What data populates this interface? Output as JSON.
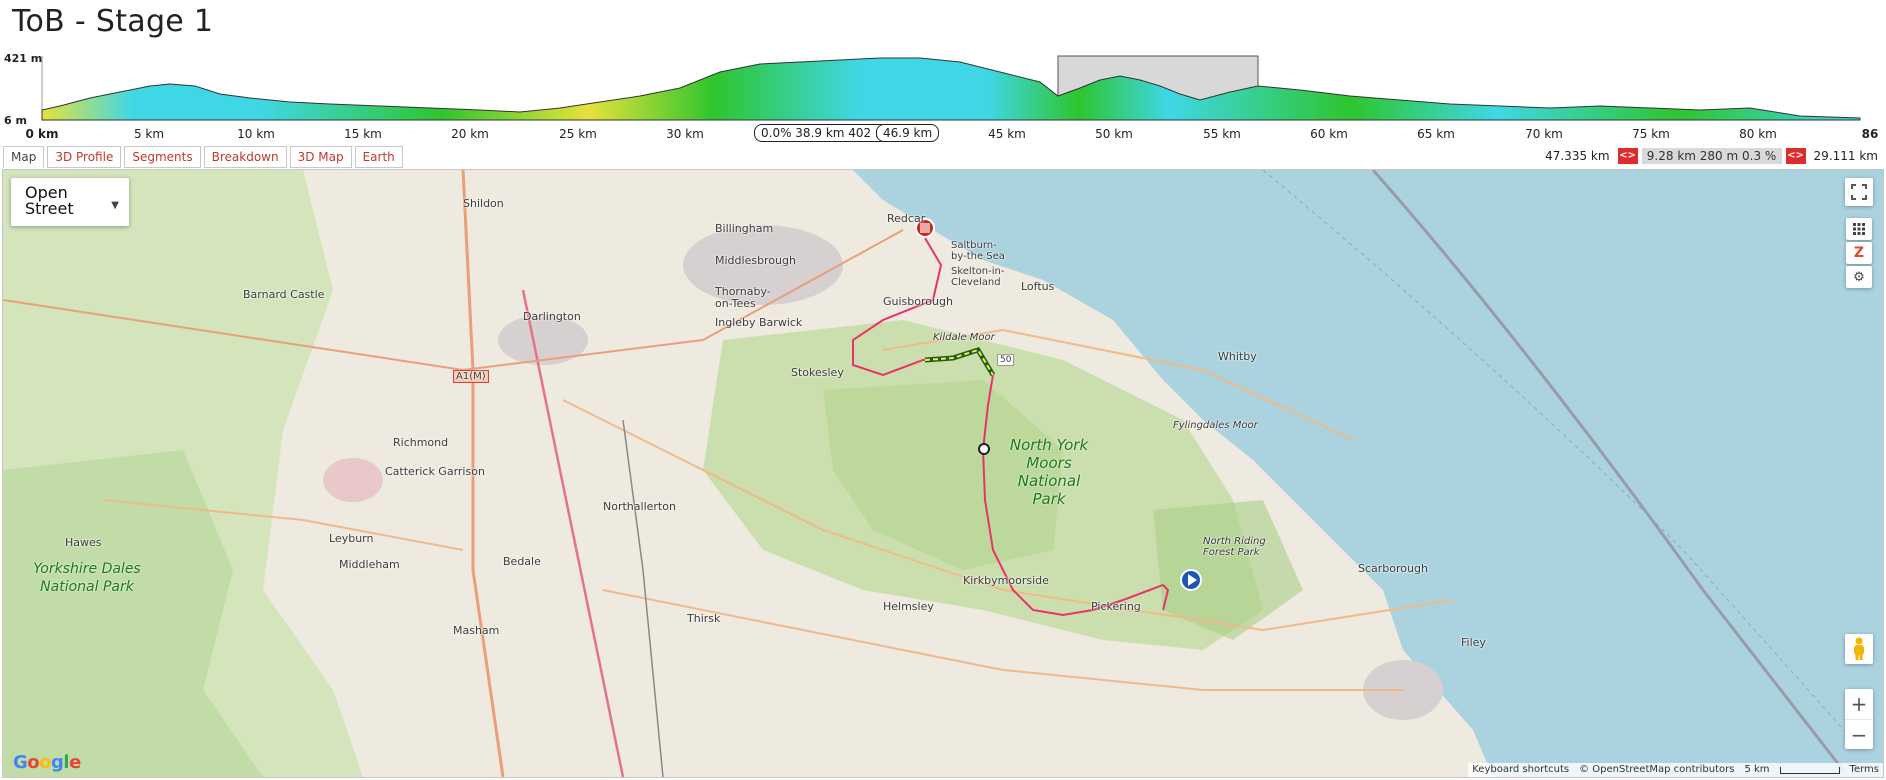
{
  "page": {
    "title": "ToB - Stage 1"
  },
  "profile": {
    "elev_max": "421 m",
    "elev_min": "6 m",
    "km_labels": [
      "0 km",
      "5 km",
      "10 km",
      "15 km",
      "20 km",
      "25 km",
      "30 km",
      "45 km",
      "50 km",
      "55 km",
      "60 km",
      "65 km",
      "70 km",
      "75 km",
      "80 km",
      "86"
    ],
    "selection_stats": "0.0% 38.9 km 402 m",
    "selection_km": "46.9 km",
    "colors": {
      "fill_low": "#3fd7e6",
      "fill_mid": "#2ec52e",
      "fill_high": "#e6e23a",
      "selection": "#d8d8d8"
    }
  },
  "tabs": [
    {
      "label": "Map",
      "active": true
    },
    {
      "label": "3D Profile",
      "active": false
    },
    {
      "label": "Segments",
      "active": false
    },
    {
      "label": "Breakdown",
      "active": false
    },
    {
      "label": "3D Map",
      "active": false
    },
    {
      "label": "Earth",
      "active": false
    }
  ],
  "range": {
    "start": "47.335 km",
    "stats": "9.28 km 280 m 0.3 %",
    "end": "29.111 km",
    "arrows": "<>"
  },
  "map": {
    "type_label": "Open Street",
    "places": [
      "Shildon",
      "Billingham",
      "Redcar",
      "Saltburn-by-the Sea",
      "Middlesbrough",
      "Skelton-in-Cleveland",
      "Loftus",
      "Thornaby-on-Tees",
      "Barnard Castle",
      "Darlington",
      "Ingleby Barwick",
      "Guisborough",
      "Kildale Moor",
      "Whitby",
      "A1(M)",
      "Stokesley",
      "Richmond",
      "Catterick Garrison",
      "Fylingdales Moor",
      "Northallerton",
      "Hawes",
      "Leyburn",
      "Bedale",
      "Middleham",
      "North Riding Forest Park",
      "Scarborough",
      "Kirkbymoorside",
      "Helmsley",
      "Pickering",
      "Thirsk",
      "Masham",
      "Filey",
      "50"
    ],
    "parks": [
      "North York Moors National Park",
      "Yorkshire Dales National Park"
    ],
    "google": "Google",
    "attribution": [
      "Keyboard shortcuts",
      "© OpenStreetMap contributors",
      "5 km",
      "Terms"
    ]
  }
}
